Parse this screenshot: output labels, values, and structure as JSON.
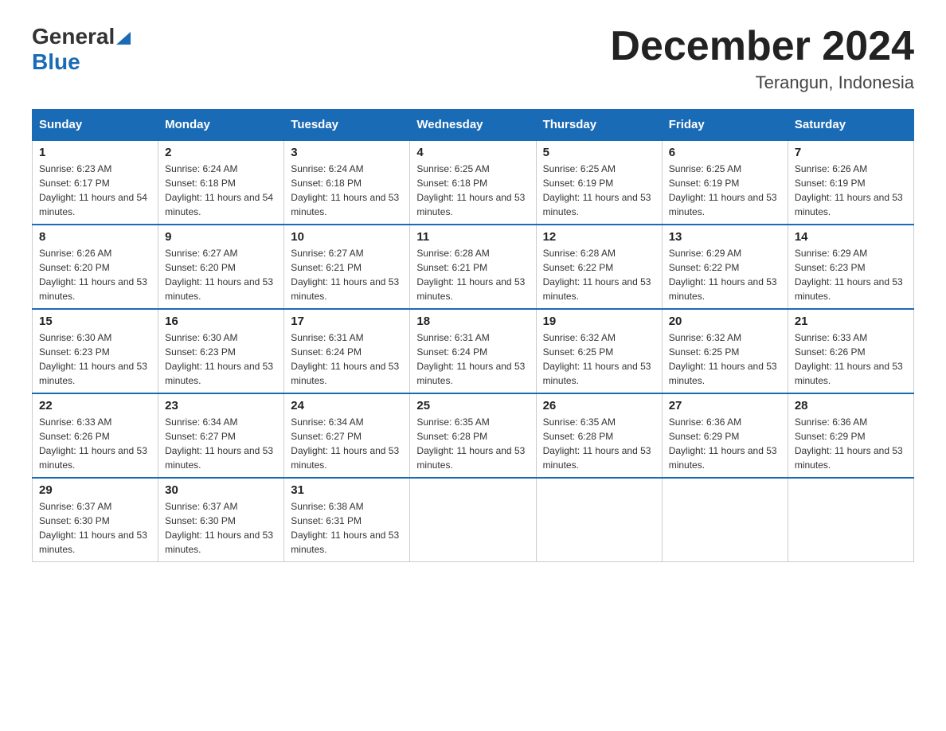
{
  "header": {
    "logo_general": "General",
    "logo_blue": "Blue",
    "title": "December 2024",
    "subtitle": "Terangun, Indonesia"
  },
  "days_of_week": [
    "Sunday",
    "Monday",
    "Tuesday",
    "Wednesday",
    "Thursday",
    "Friday",
    "Saturday"
  ],
  "weeks": [
    [
      {
        "day": "1",
        "sunrise": "6:23 AM",
        "sunset": "6:17 PM",
        "daylight": "11 hours and 54 minutes."
      },
      {
        "day": "2",
        "sunrise": "6:24 AM",
        "sunset": "6:18 PM",
        "daylight": "11 hours and 54 minutes."
      },
      {
        "day": "3",
        "sunrise": "6:24 AM",
        "sunset": "6:18 PM",
        "daylight": "11 hours and 53 minutes."
      },
      {
        "day": "4",
        "sunrise": "6:25 AM",
        "sunset": "6:18 PM",
        "daylight": "11 hours and 53 minutes."
      },
      {
        "day": "5",
        "sunrise": "6:25 AM",
        "sunset": "6:19 PM",
        "daylight": "11 hours and 53 minutes."
      },
      {
        "day": "6",
        "sunrise": "6:25 AM",
        "sunset": "6:19 PM",
        "daylight": "11 hours and 53 minutes."
      },
      {
        "day": "7",
        "sunrise": "6:26 AM",
        "sunset": "6:19 PM",
        "daylight": "11 hours and 53 minutes."
      }
    ],
    [
      {
        "day": "8",
        "sunrise": "6:26 AM",
        "sunset": "6:20 PM",
        "daylight": "11 hours and 53 minutes."
      },
      {
        "day": "9",
        "sunrise": "6:27 AM",
        "sunset": "6:20 PM",
        "daylight": "11 hours and 53 minutes."
      },
      {
        "day": "10",
        "sunrise": "6:27 AM",
        "sunset": "6:21 PM",
        "daylight": "11 hours and 53 minutes."
      },
      {
        "day": "11",
        "sunrise": "6:28 AM",
        "sunset": "6:21 PM",
        "daylight": "11 hours and 53 minutes."
      },
      {
        "day": "12",
        "sunrise": "6:28 AM",
        "sunset": "6:22 PM",
        "daylight": "11 hours and 53 minutes."
      },
      {
        "day": "13",
        "sunrise": "6:29 AM",
        "sunset": "6:22 PM",
        "daylight": "11 hours and 53 minutes."
      },
      {
        "day": "14",
        "sunrise": "6:29 AM",
        "sunset": "6:23 PM",
        "daylight": "11 hours and 53 minutes."
      }
    ],
    [
      {
        "day": "15",
        "sunrise": "6:30 AM",
        "sunset": "6:23 PM",
        "daylight": "11 hours and 53 minutes."
      },
      {
        "day": "16",
        "sunrise": "6:30 AM",
        "sunset": "6:23 PM",
        "daylight": "11 hours and 53 minutes."
      },
      {
        "day": "17",
        "sunrise": "6:31 AM",
        "sunset": "6:24 PM",
        "daylight": "11 hours and 53 minutes."
      },
      {
        "day": "18",
        "sunrise": "6:31 AM",
        "sunset": "6:24 PM",
        "daylight": "11 hours and 53 minutes."
      },
      {
        "day": "19",
        "sunrise": "6:32 AM",
        "sunset": "6:25 PM",
        "daylight": "11 hours and 53 minutes."
      },
      {
        "day": "20",
        "sunrise": "6:32 AM",
        "sunset": "6:25 PM",
        "daylight": "11 hours and 53 minutes."
      },
      {
        "day": "21",
        "sunrise": "6:33 AM",
        "sunset": "6:26 PM",
        "daylight": "11 hours and 53 minutes."
      }
    ],
    [
      {
        "day": "22",
        "sunrise": "6:33 AM",
        "sunset": "6:26 PM",
        "daylight": "11 hours and 53 minutes."
      },
      {
        "day": "23",
        "sunrise": "6:34 AM",
        "sunset": "6:27 PM",
        "daylight": "11 hours and 53 minutes."
      },
      {
        "day": "24",
        "sunrise": "6:34 AM",
        "sunset": "6:27 PM",
        "daylight": "11 hours and 53 minutes."
      },
      {
        "day": "25",
        "sunrise": "6:35 AM",
        "sunset": "6:28 PM",
        "daylight": "11 hours and 53 minutes."
      },
      {
        "day": "26",
        "sunrise": "6:35 AM",
        "sunset": "6:28 PM",
        "daylight": "11 hours and 53 minutes."
      },
      {
        "day": "27",
        "sunrise": "6:36 AM",
        "sunset": "6:29 PM",
        "daylight": "11 hours and 53 minutes."
      },
      {
        "day": "28",
        "sunrise": "6:36 AM",
        "sunset": "6:29 PM",
        "daylight": "11 hours and 53 minutes."
      }
    ],
    [
      {
        "day": "29",
        "sunrise": "6:37 AM",
        "sunset": "6:30 PM",
        "daylight": "11 hours and 53 minutes."
      },
      {
        "day": "30",
        "sunrise": "6:37 AM",
        "sunset": "6:30 PM",
        "daylight": "11 hours and 53 minutes."
      },
      {
        "day": "31",
        "sunrise": "6:38 AM",
        "sunset": "6:31 PM",
        "daylight": "11 hours and 53 minutes."
      },
      null,
      null,
      null,
      null
    ]
  ]
}
